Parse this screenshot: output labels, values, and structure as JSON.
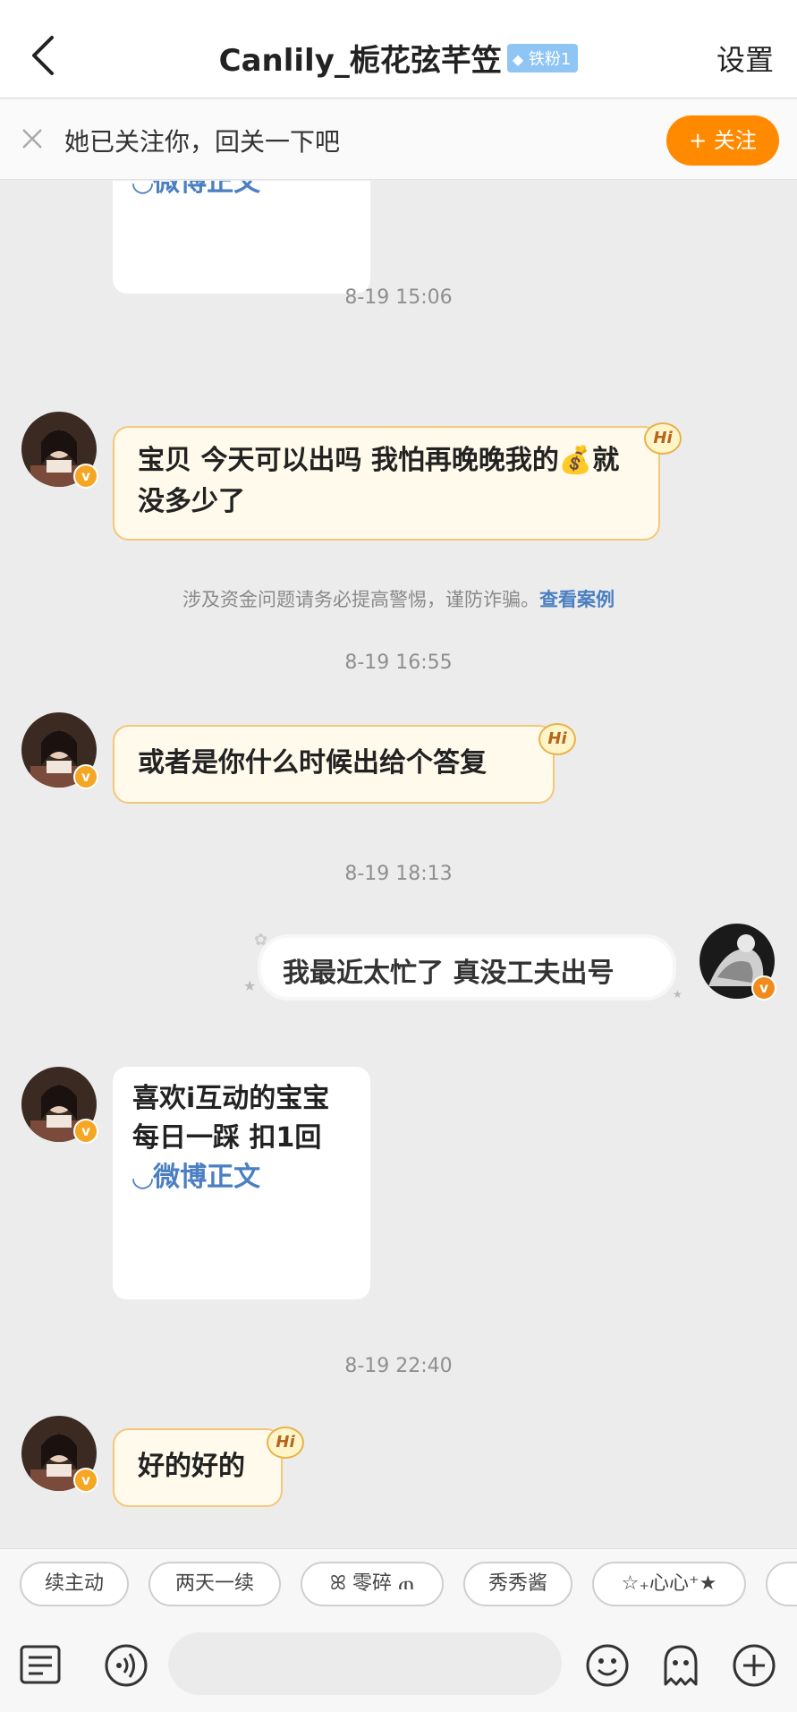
{
  "header": {
    "title": "Canlily_栀花弦芊笠",
    "fan_badge": "铁粉1",
    "settings_label": "设置"
  },
  "follow_bar": {
    "text": "她已关注你，回关一下吧",
    "button_label": "+ 关注"
  },
  "messages": {
    "partial_card_link": "◡微博正文",
    "time1": "8-19 15:06",
    "msg1": "宝贝 今天可以出吗 我怕再晚晚我的💰就没多少了",
    "hi": "Hi",
    "notice_text": "涉及资金问题请务必提高警惕，谨防诈骗。",
    "notice_link": "查看案例",
    "time2": "8-19 16:55",
    "msg2": "或者是你什么时候出给个答复",
    "time3": "8-19 18:13",
    "msg3": "我最近太忙了 真没工夫出号",
    "card_line1": "喜欢i互动的宝宝",
    "card_line2": "每日一踩 扣1回",
    "card_link": "◡微博正文",
    "time4": "8-19 22:40",
    "msg4": "好的好的",
    "verified_mark": "v"
  },
  "quick_replies": [
    "续主动",
    "两天一续",
    "ꕤ 零碎 ጠ",
    "秀秀酱",
    "☆₊心心⁺★"
  ],
  "colors": {
    "accent_orange": "#ff8a00",
    "bubble_border": "#f4c77a",
    "link_blue": "#4a7fc1"
  },
  "icons": [
    "back-icon",
    "close-icon",
    "list-icon",
    "voice-icon",
    "emoji-icon",
    "ghost-icon",
    "plus-icon"
  ]
}
